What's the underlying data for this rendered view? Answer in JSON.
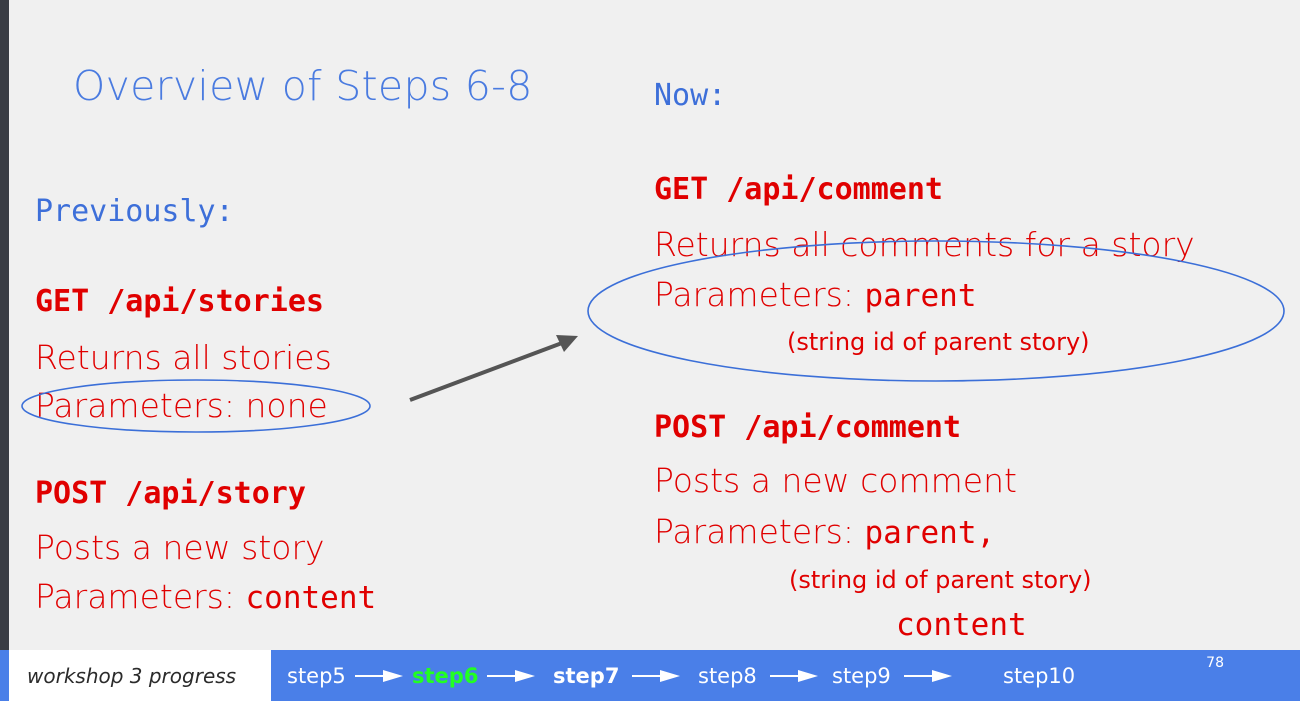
{
  "slide": {
    "title": "Overview of Steps 6-8",
    "previously_label": "Previously:",
    "now_label": "Now:",
    "left": {
      "get_endpoint": "GET /api/stories",
      "get_desc": "Returns all stories",
      "get_params": "Parameters: none",
      "post_endpoint": "POST /api/story",
      "post_desc": "Posts a new story",
      "post_params_prefix": "Parameters: ",
      "post_params_code": "content"
    },
    "right": {
      "get_endpoint": "GET /api/comment",
      "get_desc": "Returns all comments for a story",
      "get_params_prefix": "Parameters: ",
      "get_params_code": "parent",
      "get_params_note": "(string id of parent story)",
      "post_endpoint": "POST /api/comment",
      "post_desc": "Posts a new comment",
      "post_params_prefix": "Parameters: ",
      "post_params_code": "parent,",
      "post_params_note": "(string id of parent story)",
      "post_params_code2": "content"
    }
  },
  "footer": {
    "label": "workshop 3 progress",
    "steps": [
      "step5",
      "step6",
      "step7",
      "step8",
      "step9",
      "step10"
    ],
    "page_number": "78"
  },
  "colors": {
    "accent_blue": "#4a7be0",
    "endpoint_red": "#e00000",
    "footer_blue": "#4a7fe8",
    "active_green": "#22ff22"
  }
}
